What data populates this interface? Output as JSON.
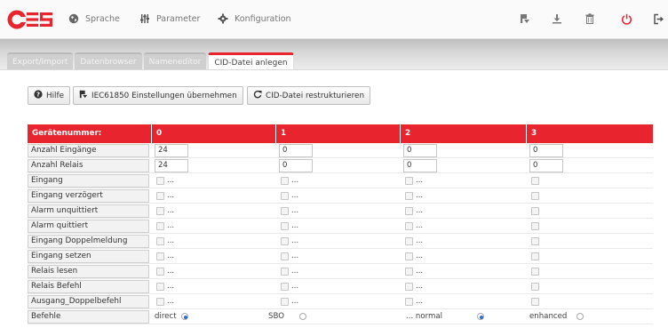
{
  "nav": {
    "items": [
      {
        "label": "Sprache",
        "icon": "globe-icon"
      },
      {
        "label": "Parameter",
        "icon": "sliders-icon"
      },
      {
        "label": "Konfiguration",
        "icon": "gear-icon"
      }
    ],
    "right_icons": [
      "save-icon",
      "download-icon",
      "trash-icon",
      "power-icon",
      "logout-icon"
    ],
    "accent_color": "#e8242f"
  },
  "tabs": [
    {
      "label": "Export/Import",
      "active": false
    },
    {
      "label": "Datenbrowser",
      "active": false
    },
    {
      "label": "Nameneditor",
      "active": false
    },
    {
      "label": "CID-Datei anlegen",
      "active": true
    }
  ],
  "toolbar": {
    "help_label": "Hilfe",
    "apply_label": "IEC61850 Einstellungen übernehmen",
    "restructure_label": "CID-Datei restrukturieren"
  },
  "table": {
    "header_label": "Gerätenummer:",
    "columns": [
      "0",
      "1",
      "2",
      "3"
    ],
    "input_rows": [
      {
        "label": "Anzahl Eingänge",
        "values": [
          "24",
          "0",
          "0",
          "0"
        ]
      },
      {
        "label": "Anzahl Relais",
        "values": [
          "24",
          "0",
          "0",
          "0"
        ]
      }
    ],
    "checkbox_rows": [
      {
        "label": "Eingang"
      },
      {
        "label": "Eingang verzögert"
      },
      {
        "label": "Alarm unquittiert"
      },
      {
        "label": "Alarm quittiert"
      },
      {
        "label": "Eingang Doppelmeldung"
      },
      {
        "label": "Eingang setzen"
      },
      {
        "label": "Relais lesen"
      },
      {
        "label": "Relais Befehl"
      },
      {
        "label": "Ausgang_Doppelbefehl"
      }
    ],
    "checkbox_suffix": "...",
    "befehle": {
      "label": "Befehle",
      "options": [
        {
          "label": "direct",
          "selected": true
        },
        {
          "label": "SBO",
          "selected": false
        },
        {
          "label": "... normal",
          "selected": true
        },
        {
          "label": "enhanced",
          "selected": false
        }
      ]
    }
  }
}
